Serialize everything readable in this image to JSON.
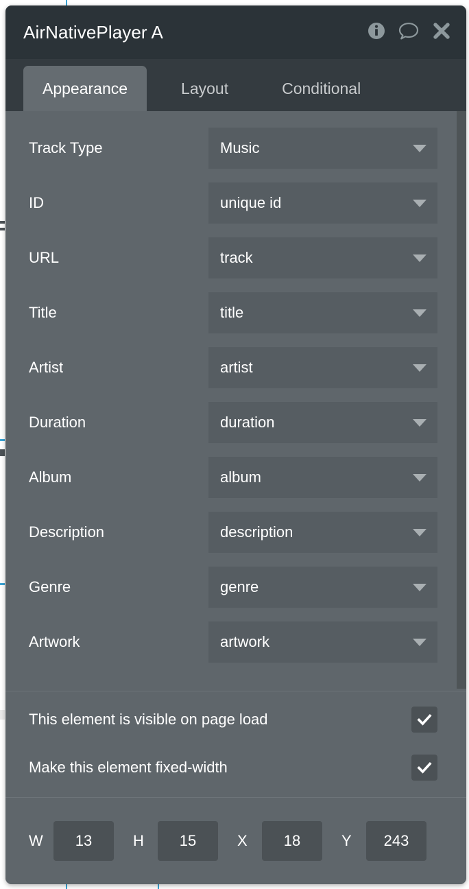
{
  "window": {
    "title": "AirNativePlayer A",
    "actions": [
      {
        "name": "info-icon",
        "label": "Info"
      },
      {
        "name": "comment-icon",
        "label": "Comment"
      },
      {
        "name": "close-icon",
        "label": "Close"
      }
    ]
  },
  "tabs": [
    {
      "label": "Appearance",
      "active": true
    },
    {
      "label": "Layout",
      "active": false
    },
    {
      "label": "Conditional",
      "active": false
    }
  ],
  "fields": [
    {
      "label": "Track Type",
      "value": "Music"
    },
    {
      "label": "ID",
      "value": "unique id"
    },
    {
      "label": "URL",
      "value": "track"
    },
    {
      "label": "Title",
      "value": "title"
    },
    {
      "label": "Artist",
      "value": "artist"
    },
    {
      "label": "Duration",
      "value": "duration"
    },
    {
      "label": "Album",
      "value": "album"
    },
    {
      "label": "Description",
      "value": "description"
    },
    {
      "label": "Genre",
      "value": "genre"
    },
    {
      "label": "Artwork",
      "value": "artwork"
    }
  ],
  "checkboxes": [
    {
      "label": "This element is visible on page load",
      "checked": true
    },
    {
      "label": "Make this element fixed-width",
      "checked": true
    }
  ],
  "geometry": [
    {
      "label": "W",
      "value": "13"
    },
    {
      "label": "H",
      "value": "15"
    },
    {
      "label": "X",
      "value": "18"
    },
    {
      "label": "Y",
      "value": "243"
    }
  ],
  "colors": {
    "titlebar": "#2b3338",
    "tabstrip": "#343b40",
    "panel": "#5f666b",
    "field": "#565d62",
    "input": "#4b5155",
    "accent": "#3aa3d4",
    "text": "#ffffff"
  }
}
